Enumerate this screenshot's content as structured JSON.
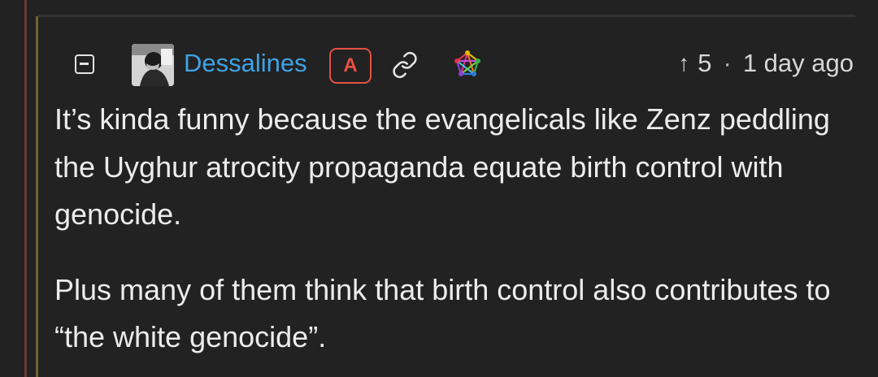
{
  "comment": {
    "author": "Dessalines",
    "badge": "A",
    "score": "5",
    "separator": "·",
    "timestamp": "1 day ago",
    "icons": {
      "collapse": "collapse-minus-icon",
      "link": "link-icon",
      "instance": "instance-star-icon",
      "upvote": "arrow-up-icon"
    },
    "paragraphs": [
      "It’s kinda funny because the evangelicals like Zenz peddling the Uyghur atrocity propaganda equate birth control with genocide.",
      "Plus many of them think that birth control also contributes to “the white genocide”."
    ]
  },
  "colors": {
    "background": "#222222",
    "username": "#3fa3e6",
    "admin_badge": "#e55143",
    "text": "#ececec",
    "meta": "#d7d7d7"
  }
}
